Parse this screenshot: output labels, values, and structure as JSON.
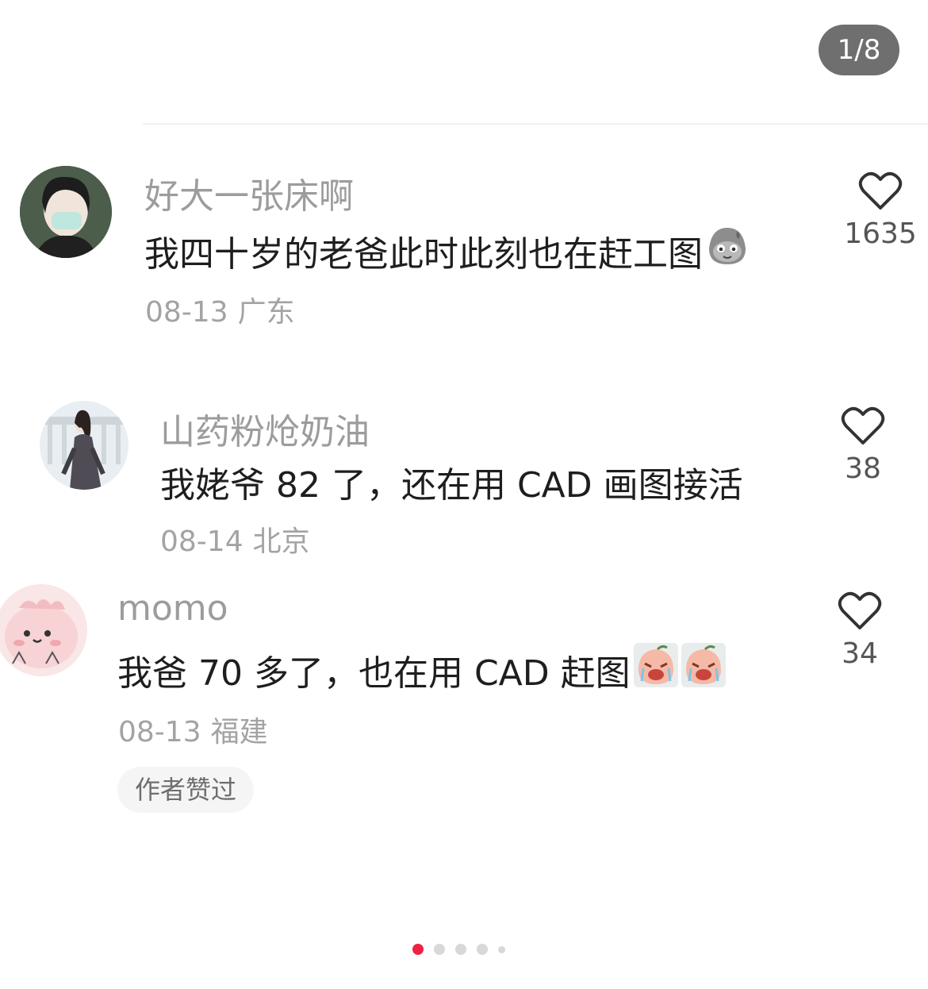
{
  "pager": {
    "label": "1/8"
  },
  "comments": [
    {
      "username": "好大一张床啊",
      "text": "我四十岁的老爸此时此刻也在赶工图",
      "emoji": "sweat-face-icon",
      "date": "08-13",
      "location": "广东",
      "likes": "1635"
    },
    {
      "username": "山药粉炝奶油",
      "text": "我姥爷 82 了，还在用 CAD 画图接活",
      "date": "08-14",
      "location": "北京",
      "likes": "38"
    },
    {
      "username": "momo",
      "text": "我爸 70 多了，也在用 CAD 赶图",
      "emoji": "crying-peach-icon",
      "date": "08-13",
      "location": "福建",
      "likes": "34",
      "badge": "作者赞过"
    }
  ],
  "carousel": {
    "count": 5,
    "active": 0
  },
  "colors": {
    "accent": "#ee2244",
    "pager_bg": "#6f6f6f"
  }
}
